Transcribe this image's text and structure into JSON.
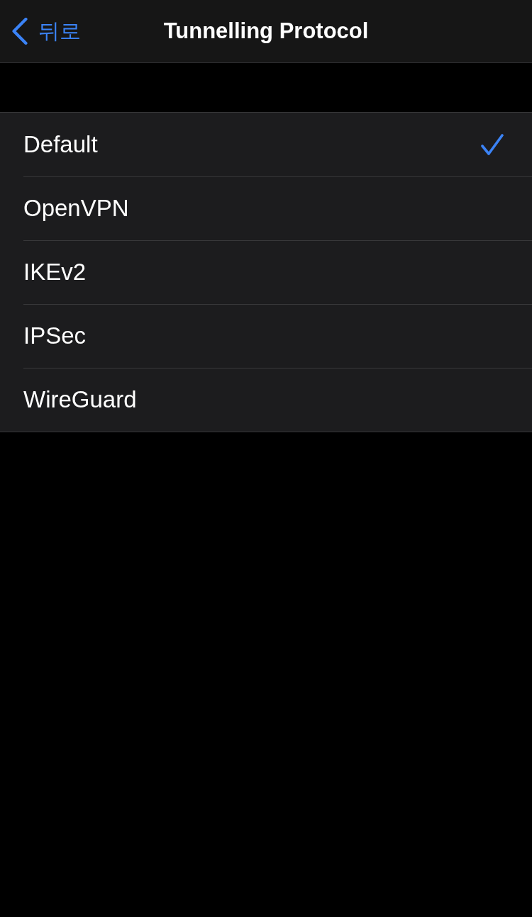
{
  "nav_bar": {
    "back_button": {
      "label": "뒤로"
    },
    "title": "Tunnelling Protocol"
  },
  "options": [
    {
      "label": "Default",
      "selected": true
    },
    {
      "label": "OpenVPN",
      "selected": false
    },
    {
      "label": "IKEv2",
      "selected": false
    },
    {
      "label": "IPSec",
      "selected": false
    },
    {
      "label": "WireGuard",
      "selected": false
    }
  ]
}
